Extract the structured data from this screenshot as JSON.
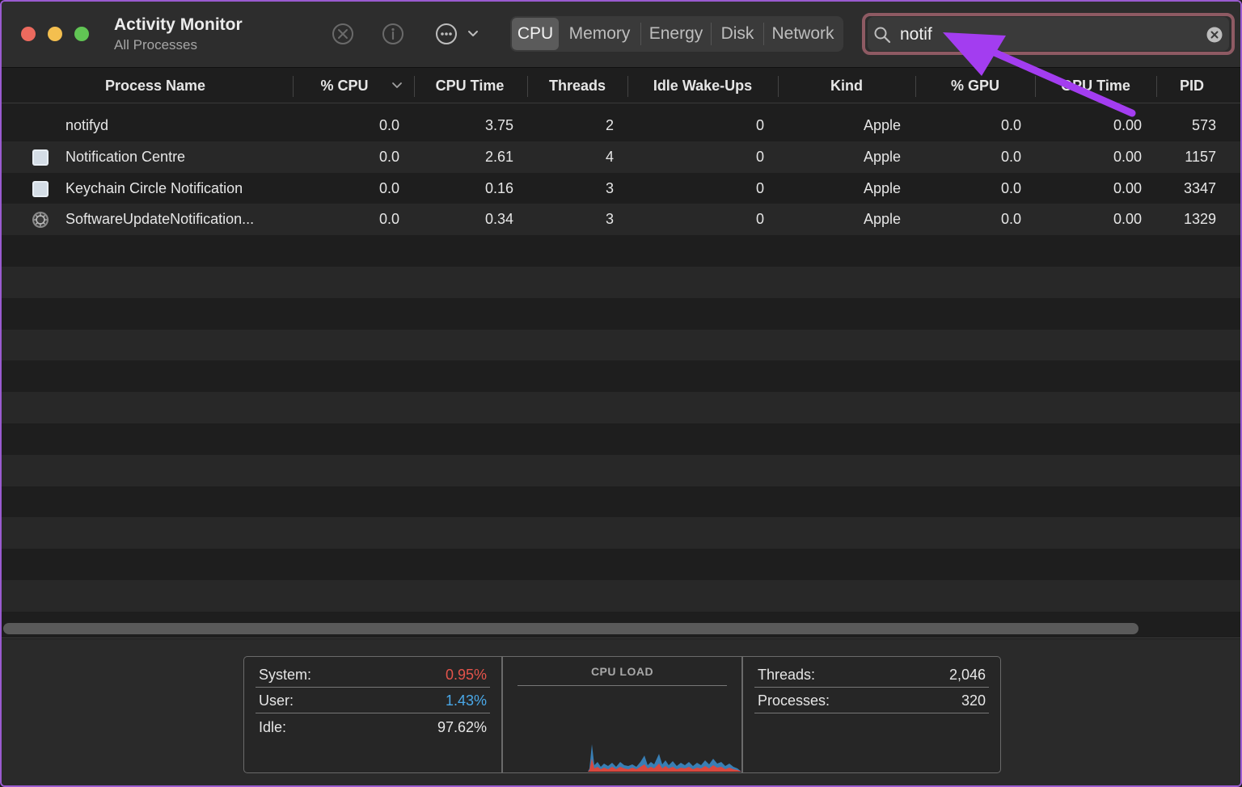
{
  "window": {
    "title": "Activity Monitor",
    "subtitle": "All Processes"
  },
  "toolbar": {
    "stop_icon": "stop-process-icon",
    "info_icon": "info-icon",
    "more_icon": "more-options-icon",
    "tabs": [
      {
        "label": "CPU",
        "active": true
      },
      {
        "label": "Memory",
        "active": false
      },
      {
        "label": "Energy",
        "active": false
      },
      {
        "label": "Disk",
        "active": false
      },
      {
        "label": "Network",
        "active": false
      }
    ]
  },
  "search": {
    "value": "notif",
    "highlight_color": "#8e5a63"
  },
  "table": {
    "columns": [
      "Process Name",
      "% CPU",
      "CPU Time",
      "Threads",
      "Idle Wake-Ups",
      "Kind",
      "% GPU",
      "GPU Time",
      "PID"
    ],
    "rows": [
      {
        "name": "notifyd",
        "icon": "none",
        "cpu": "0.0",
        "cpu_time": "3.75",
        "threads": "2",
        "idle_wakeups": "0",
        "kind": "Apple",
        "gpu": "0.0",
        "gpu_time": "0.00",
        "pid": "573"
      },
      {
        "name": "Notification Centre",
        "icon": "app-window-icon",
        "cpu": "0.0",
        "cpu_time": "2.61",
        "threads": "4",
        "idle_wakeups": "0",
        "kind": "Apple",
        "gpu": "0.0",
        "gpu_time": "0.00",
        "pid": "1157"
      },
      {
        "name": "Keychain Circle Notification",
        "icon": "app-window-icon",
        "cpu": "0.0",
        "cpu_time": "0.16",
        "threads": "3",
        "idle_wakeups": "0",
        "kind": "Apple",
        "gpu": "0.0",
        "gpu_time": "0.00",
        "pid": "3347"
      },
      {
        "name": "SoftwareUpdateNotification...",
        "icon": "settings-gear-icon",
        "cpu": "0.0",
        "cpu_time": "0.34",
        "threads": "3",
        "idle_wakeups": "0",
        "kind": "Apple",
        "gpu": "0.0",
        "gpu_time": "0.00",
        "pid": "1329"
      }
    ]
  },
  "summary": {
    "system_label": "System:",
    "system_value": "0.95%",
    "system_color": "#e5544b",
    "user_label": "User:",
    "user_value": "1.43%",
    "user_color": "#4aa8e8",
    "idle_label": "Idle:",
    "idle_value": "97.62%",
    "cpu_load_title": "CPU LOAD",
    "threads_label": "Threads:",
    "threads_value": "2,046",
    "processes_label": "Processes:",
    "processes_value": "320"
  },
  "annotation": {
    "arrow_color": "#a33df0"
  }
}
